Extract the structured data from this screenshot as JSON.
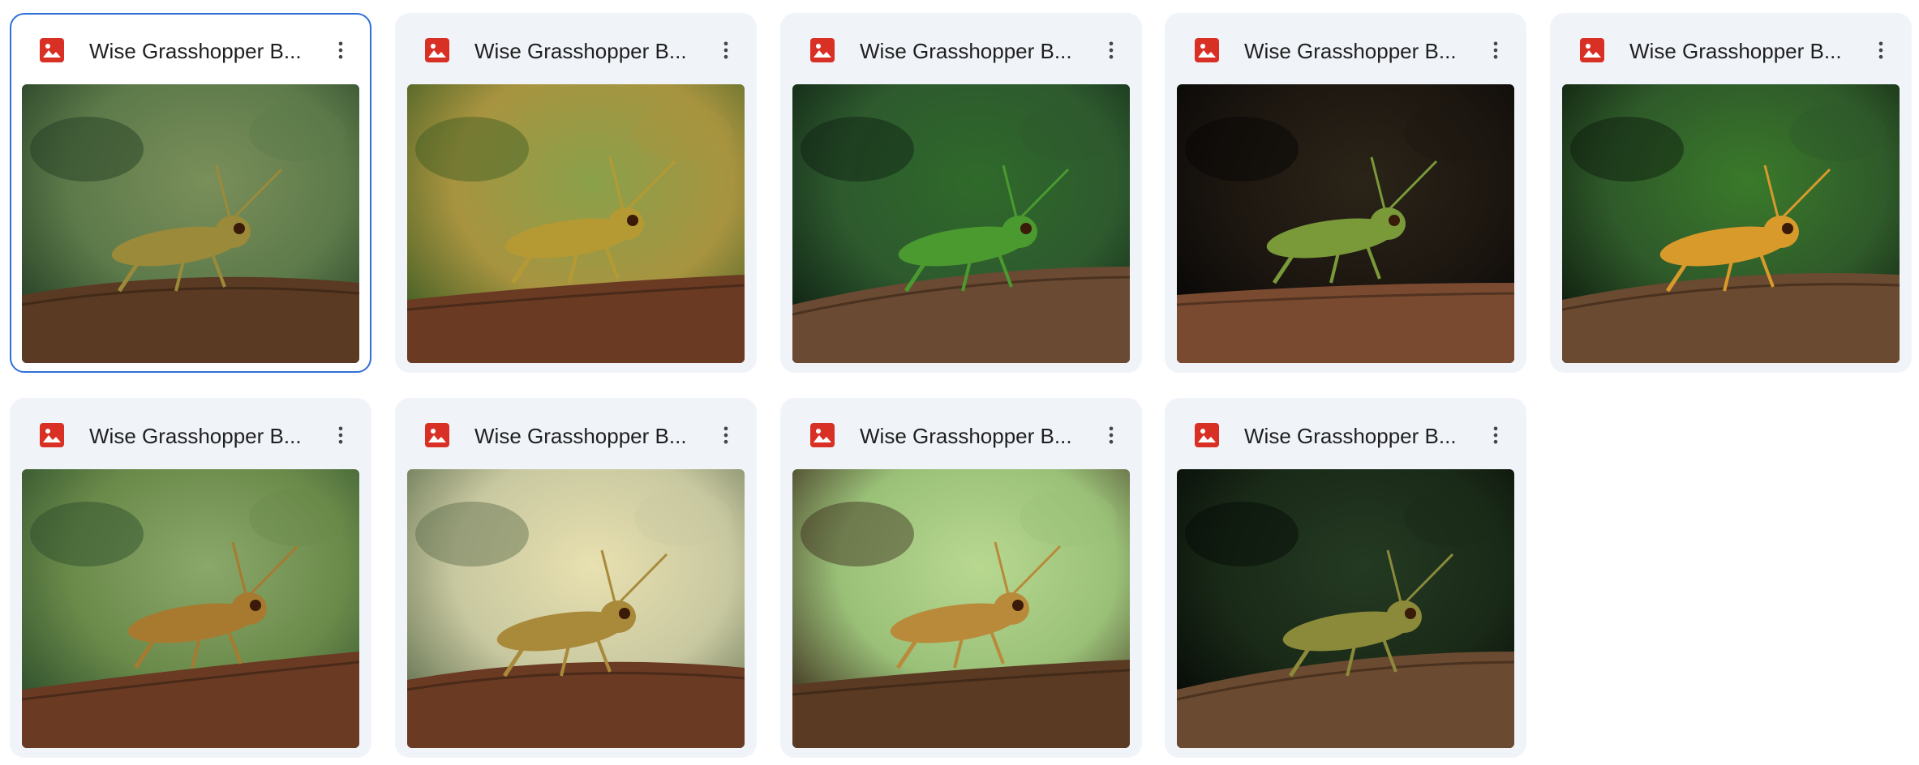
{
  "files": [
    {
      "title": "Wise Grasshopper B...",
      "selected": true,
      "bg1": "#1f3a22",
      "bg2": "#5d7a4a",
      "branch": "#5a3a22",
      "body": "#9a8a3a",
      "glow": "#7a8f5a"
    },
    {
      "title": "Wise Grasshopper B...",
      "selected": false,
      "bg1": "#3b5a22",
      "bg2": "#a89440",
      "branch": "#6a3a22",
      "body": "#b59a34",
      "glow": "#8aa04a"
    },
    {
      "title": "Wise Grasshopper B...",
      "selected": false,
      "bg1": "#0d1e12",
      "bg2": "#2e5a2e",
      "branch": "#6a4a32",
      "body": "#4a9a30",
      "glow": "#2f6a2a"
    },
    {
      "title": "Wise Grasshopper B...",
      "selected": false,
      "bg1": "#050505",
      "bg2": "#1c1610",
      "branch": "#7a4a30",
      "body": "#7a9a3a",
      "glow": "#2a2418"
    },
    {
      "title": "Wise Grasshopper B...",
      "selected": false,
      "bg1": "#0c180c",
      "bg2": "#2f5a2a",
      "branch": "#6a4a30",
      "body": "#d89a2a",
      "glow": "#3a7a2a"
    },
    {
      "title": "Wise Grasshopper B...",
      "selected": false,
      "bg1": "#2a4a2a",
      "bg2": "#6a8a4a",
      "branch": "#6a3a22",
      "body": "#a87a30",
      "glow": "#8aa86a"
    },
    {
      "title": "Wise Grasshopper B...",
      "selected": false,
      "bg1": "#5a6a4a",
      "bg2": "#c8c8a0",
      "branch": "#6a3a22",
      "body": "#a88a3a",
      "glow": "#e8e0b0"
    },
    {
      "title": "Wise Grasshopper B...",
      "selected": false,
      "bg1": "#3a2a1a",
      "bg2": "#9ac078",
      "branch": "#5a3a22",
      "body": "#b88a3a",
      "glow": "#b8d890"
    },
    {
      "title": "Wise Grasshopper B...",
      "selected": false,
      "bg1": "#050805",
      "bg2": "#1a2a18",
      "branch": "#6a4a30",
      "body": "#8a8a3a",
      "glow": "#243a22"
    }
  ],
  "icons": {
    "file": "image-file-icon",
    "more": "more-vert-icon"
  },
  "colors": {
    "file_icon": "#d93025",
    "selected_border": "#2f6fd8",
    "card_bg": "#f0f4f9"
  }
}
